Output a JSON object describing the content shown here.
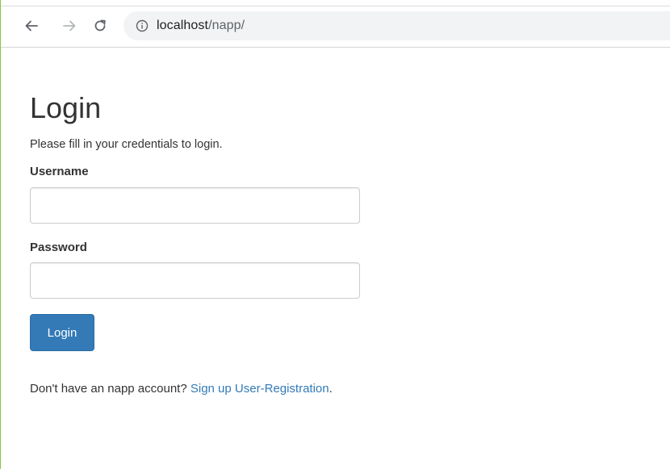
{
  "browser": {
    "url_host": "localhost",
    "url_path": "/napp/",
    "icons": {
      "back": "arrow-left-icon",
      "forward": "arrow-right-icon",
      "reload": "reload-icon",
      "info": "info-circle-icon"
    }
  },
  "page": {
    "title": "Login",
    "subtitle": "Please fill in your credentials to login.",
    "username_label": "Username",
    "username_value": "",
    "password_label": "Password",
    "password_value": "",
    "login_button": "Login",
    "signup_prompt": "Don't have an napp account? ",
    "signup_link": "Sign up User-Registration",
    "signup_suffix": "."
  },
  "colors": {
    "primary": "#337ab7",
    "text": "#333333",
    "omnibox_bg": "#f1f3f4"
  }
}
